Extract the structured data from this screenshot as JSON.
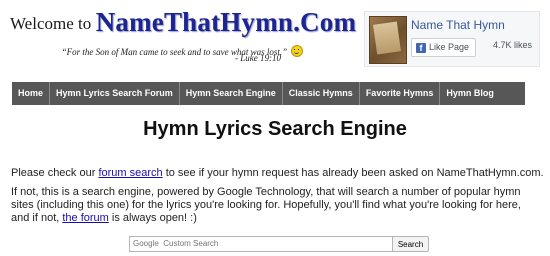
{
  "header": {
    "welcome": "Welcome to",
    "site_name": "NameThatHymn.Com",
    "quote": "“For the Son of Man came to seek and to save what was lost.”",
    "verse": "- Luke 19:10"
  },
  "facebook": {
    "page_name": "Name That Hymn",
    "like_label": "Like Page",
    "likes": "4.7K likes"
  },
  "nav": {
    "items": [
      "Home",
      "Hymn Lyrics Search Forum",
      "Hymn Search Engine",
      "Classic Hymns",
      "Favorite Hymns",
      "Hymn Blog"
    ]
  },
  "main": {
    "title": "Hymn Lyrics Search Engine",
    "p1_before": "Please check our ",
    "p1_link": "forum search",
    "p1_after": " to see if your hymn request has already been asked on NameThatHymn.com.",
    "p2_before": "If not, this is a search engine, powered by Google Technology, that will search a number of popular hymn sites (including this one) for the lyrics you're looking for. Hopefully, you'll find what you're looking for here, and if not, ",
    "p2_link": "the forum",
    "p2_after": " is always open! :)"
  },
  "search": {
    "placeholder": "Google  Custom Search",
    "button_label": "Search"
  }
}
